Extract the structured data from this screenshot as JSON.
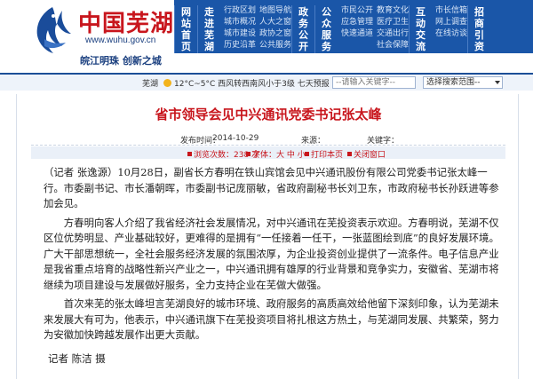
{
  "site": {
    "logo_title": "中国芜湖",
    "url": "www.wuhu.gov.cn",
    "slogan": "皖江明珠  创新之城"
  },
  "nav": [
    {
      "main": [
        "网",
        "站",
        "首",
        "页"
      ],
      "subs": []
    },
    {
      "main": [
        "走",
        "进",
        "芜",
        "湖"
      ],
      "subs": [
        "行政区划",
        "城市概况",
        "城市建设",
        "历史沿革"
      ]
    },
    {
      "main": [
        "政",
        "务",
        "公",
        "开"
      ],
      "subs": [
        "地图导航",
        "人大之窗",
        "政协之窗",
        "公共服务"
      ]
    },
    {
      "main": [
        "公",
        "众",
        "服",
        "务"
      ],
      "subs": [
        "市民公开",
        "应急管理",
        "快速通道"
      ]
    },
    {
      "main": [
        "互",
        "动",
        "交",
        "流"
      ],
      "subs": [
        "教育文化",
        "医疗卫生",
        "交通出行",
        "社会保障"
      ]
    },
    {
      "main": [
        "招",
        "商",
        "引",
        "资"
      ],
      "subs": [
        "市长信箱",
        "网上调查",
        "在线访谈"
      ]
    }
  ],
  "topbar": {
    "city": "芜湖",
    "weather": "12°C~5°C  西风转西南风小于3级  七天预报",
    "search_placeholder": "--请输入关键字--",
    "scope_select": "选择搜索范围--"
  },
  "article": {
    "title": "省市领导会见中兴通讯党委书记张太峰",
    "publish_label": "发布时间：",
    "publish_date": "2014-10-29",
    "source_label": "来源：",
    "keyword_label": "关键字：",
    "views": "浏览次数：238 次",
    "font_size": "字体：大 中 小",
    "print": "打印本页",
    "close": "关闭窗口",
    "paragraphs": [
      "（记者 张逸源）10月28日，副省长方春明在铁山宾馆会见中兴通讯股份有限公司党委书记张太峰一行。市委副书记、市长潘朝晖，市委副书记庞丽敏，省政府副秘书长刘卫东，市政府秘书长孙跃进等参加会见。",
      "方春明向客人介绍了我省经济社会发展情况，对中兴通讯在芜投资表示欢迎。方春明说，芜湖不仅区位优势明显、产业基础较好，更难得的是拥有“一任接着一任干，一张蓝图绘到底”的良好发展环境。广大干部思想统一，全社会服务经济发展的氛围浓厚，为企业投资创业提供了一流条件。电子信息产业是我省重点培育的战略性新兴产业之一，中兴通讯拥有雄厚的行业背景和竞争实力，安徽省、芜湖市将继续为项目建设与发展做好服务，全力支持企业在芜做大做强。",
      "首次来芜的张太峰坦言芜湖良好的城市环境、政府服务的高质高效给他留下深刻印象，认为芜湖未来发展大有可为，他表示，中兴通讯旗下在芜投资项目将扎根这方热土，与芜湖同发展、共繁荣，努力为安徽加快跨越发展作出更大贡献。"
    ],
    "byline": "记者 陈洁 摄"
  },
  "colors": {
    "nav_bg": "#1a56a8",
    "title_red": "#c8161d",
    "accent_blue": "#1c4e97"
  }
}
